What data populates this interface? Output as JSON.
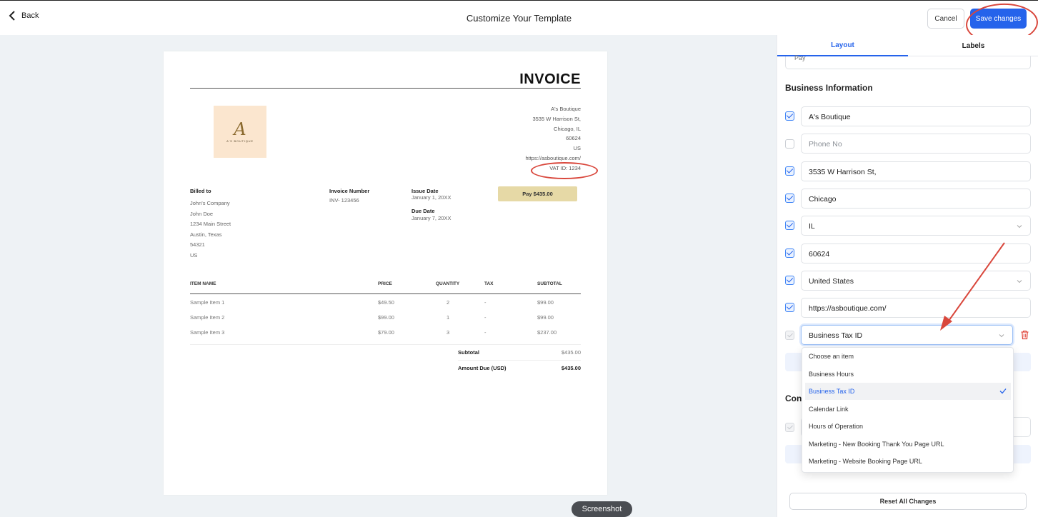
{
  "header": {
    "back_label": "Back",
    "title": "Customize Your Template",
    "cancel_label": "Cancel",
    "save_label": "Save changes"
  },
  "invoice": {
    "title": "INVOICE",
    "logo": {
      "letter": "A",
      "name": "A'S BOUTIQUE"
    },
    "business_lines": [
      "A's Boutique",
      "3535 W Harrison St,",
      "Chicago, IL",
      "60624",
      "US",
      "https://asboutique.com/",
      "VAT ID: 1234"
    ],
    "billed_to": {
      "label": "Billed to",
      "lines": [
        "John's Company",
        "John Doe",
        "1234 Main Street",
        "Austin, Texas",
        "54321",
        "US"
      ]
    },
    "invoice_number": {
      "label": "Invoice Number",
      "value": "INV- 123456"
    },
    "issue_date": {
      "label": "Issue Date",
      "value": "January 1, 20XX"
    },
    "due_date": {
      "label": "Due Date",
      "value": "January 7, 20XX"
    },
    "pay_button": "Pay $435.00",
    "table": {
      "headers": [
        "ITEM NAME",
        "PRICE",
        "QUANTITY",
        "TAX",
        "SUBTOTAL"
      ],
      "rows": [
        [
          "Sample Item 1",
          "$49.50",
          "2",
          "-",
          "$99.00"
        ],
        [
          "Sample Item 2",
          "$99.00",
          "1",
          "-",
          "$99.00"
        ],
        [
          "Sample Item 3",
          "$79.00",
          "3",
          "-",
          "$237.00"
        ]
      ]
    },
    "subtotal": {
      "label": "Subtotal",
      "value": "$435.00"
    },
    "amount_due": {
      "label": "Amount Due (USD)",
      "value": "$435.00"
    }
  },
  "panel": {
    "tabs": [
      "Layout",
      "Labels"
    ],
    "cut_value": "Pay",
    "section_title": "Business Information",
    "fields": [
      {
        "value": "A's Boutique",
        "checked": true
      },
      {
        "placeholder": "Phone No",
        "checked": false
      },
      {
        "value": "3535 W Harrison St,",
        "checked": true
      },
      {
        "value": "Chicago",
        "checked": true
      },
      {
        "value": "IL",
        "checked": true,
        "dropdown": true
      },
      {
        "value": "60624",
        "checked": true
      },
      {
        "value": "United States",
        "checked": true,
        "dropdown": true
      },
      {
        "value": "https://asboutique.com/",
        "checked": true
      },
      {
        "value": "Business Tax ID",
        "checked": true,
        "dropdown": true,
        "disabled_check": true
      }
    ],
    "dropdown_options": [
      "Choose an item",
      "Business Hours",
      "Business Tax ID",
      "Calendar Link",
      "Hours of Operation",
      "Marketing - New Booking Thank You Page URL",
      "Marketing - Website Booking Page URL"
    ],
    "dropdown_selected": "Business Tax ID",
    "cont_label": "Con",
    "reset_label": "Reset All Changes"
  },
  "overlay": {
    "screenshot_label": "Screenshot"
  },
  "colors": {
    "accent": "#2563eb",
    "annotation": "#d9473c",
    "canvas_bg": "#eef2f5",
    "pay_button": "#e6d9a6",
    "logo_bg": "#fbe6cf"
  },
  "icons": [
    "chevron-left-icon",
    "chevron-down-icon",
    "check-icon",
    "trash-icon"
  ]
}
